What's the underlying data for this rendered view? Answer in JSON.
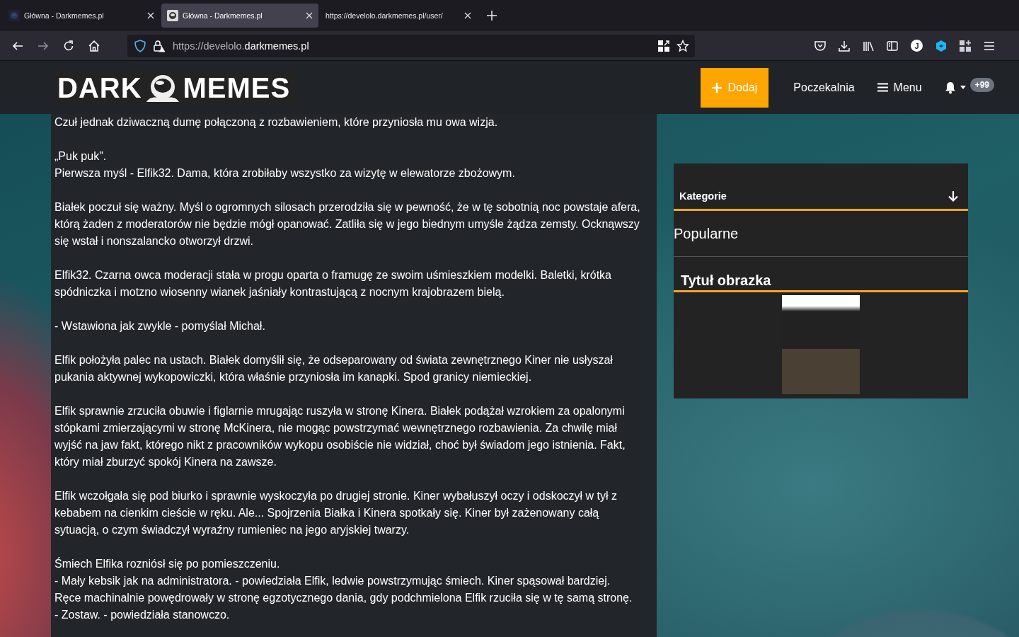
{
  "browser": {
    "tabs": [
      {
        "title": "Główna - Darkmemes.pl",
        "selected": false
      },
      {
        "title": "Główna - Darkmemes.pl",
        "selected": true
      },
      {
        "title": "https://develolo.darkmemes.pl/user/",
        "selected": false
      }
    ],
    "url": {
      "host_prefix": "https://develolo.",
      "host_main": "darkmemes.pl"
    },
    "account_initial": "J"
  },
  "header": {
    "logo": {
      "left": "DARK",
      "right": "MEMES"
    },
    "add_button": "Dodaj",
    "nav": [
      "Poczekalnia",
      "Menu"
    ],
    "notification_badge": "+99"
  },
  "article": {
    "paragraphs": [
      {
        "lines": [
          "Czuł jednak dziwaczną dumę połączoną z rozbawieniem, które przyniosła mu owa wizja."
        ]
      },
      {
        "lines": [
          "„Puk puk\".",
          "Pierwsza myśl - Elfik32. Dama, która zrobiłaby wszystko za wizytę w elewatorze zbożowym."
        ]
      },
      {
        "lines": [
          "Białek poczuł się ważny. Myśl o ogromnych silosach przerodziła się w pewność, że w tę sobotnią noc powstaje afera, którą żaden z moderatorów nie będzie mógł opanować. Zatliła się w jego biednym umyśle żądza zemsty. Ocknąwszy się wstał i nonszalancko otworzył drzwi."
        ]
      },
      {
        "lines": [
          "Elfik32. Czarna owca moderacji stała w progu oparta o framugę ze swoim uśmieszkiem modelki. Baletki, krótka spódniczka i motzno wiosenny wianek jaśniały kontrastującą z nocnym krajobrazem bielą."
        ]
      },
      {
        "lines": [
          "- Wstawiona jak zwykle - pomyślał Michał."
        ]
      },
      {
        "lines": [
          "Elfik położyła palec na ustach. Białek domyślił się, że odseparowany od świata zewnętrznego Kiner nie usłyszał pukania aktywnej wykopowiczki, która właśnie przyniosła im kanapki. Spod granicy niemieckiej."
        ]
      },
      {
        "lines": [
          "Elfik sprawnie zrzuciła obuwie i figlarnie mrugając ruszyła w stronę Kinera. Białek podążał wzrokiem za opalonymi stópkami zmierzającymi w stronę McKinera, nie mogąc powstrzymać wewnętrznego rozbawienia. Za chwilę miał wyjść na jaw fakt, którego nikt z pracowników wykopu osobiście nie widział, choć był świadom jego istnienia. Fakt, który miał zburzyć spokój Kinera na zawsze."
        ]
      },
      {
        "lines": [
          "Elfik wczołgała się pod biurko i sprawnie wyskoczyła po drugiej stronie. Kiner wybałuszył oczy i odskoczył w tył z kebabem na cienkim cieście w ręku. Ale... Spojrzenia Białka i Kinera spotkały się. Kiner był zażenowany całą sytuacją, o czym świadczył wyraźny rumieniec na jego aryjskiej twarzy."
        ]
      },
      {
        "lines": [
          "Śmiech Elfika rozniósł się po pomieszczeniu.",
          "- Mały kebsik jak na administratora. - powiedziała Elfik, ledwie powstrzymując śmiech. Kiner spąsował bardziej.",
          "Ręce machinalnie powędrowały w stronę egzotycznego dania, gdy podchmielona Elfik rzuciła się w tę samą stronę.",
          "- Zostaw. - powiedziała stanowczo."
        ]
      }
    ]
  },
  "sidebar": {
    "categories": "Kategorie",
    "popular": "Popularne",
    "image_title": "Tytuł obrazka"
  }
}
